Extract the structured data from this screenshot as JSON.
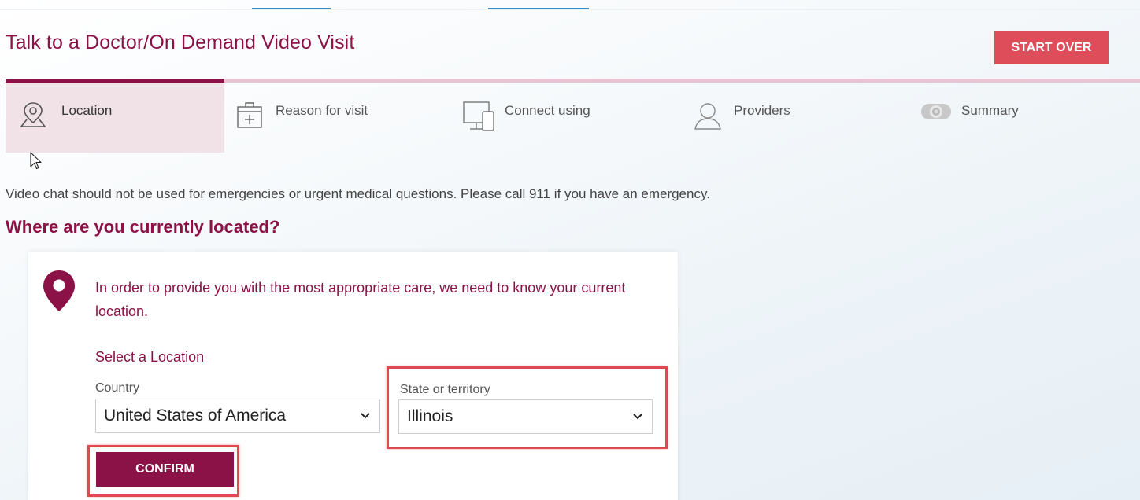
{
  "page": {
    "title": "Talk to a Doctor/On Demand Video Visit",
    "start_over_label": "START OVER",
    "accent_color": "#8b1246",
    "button_color": "#de4d5a"
  },
  "steps": [
    {
      "label": "Location",
      "icon": "map-pin-icon",
      "active": true
    },
    {
      "label": "Reason for visit",
      "icon": "first-aid-kit-icon",
      "active": false
    },
    {
      "label": "Connect using",
      "icon": "devices-icon",
      "active": false
    },
    {
      "label": "Providers",
      "icon": "person-icon",
      "active": false
    },
    {
      "label": "Summary",
      "icon": "webcam-icon",
      "active": false
    }
  ],
  "notice": "Video chat should not be used for emergencies or urgent medical questions.  Please call 911 if you have an emergency.",
  "question": "Where are you currently located?",
  "card": {
    "intro": "In order to provide you with the most appropriate care, we need to know your current location.",
    "select_heading": "Select a Location",
    "country": {
      "label": "Country",
      "value": "United States of America"
    },
    "state": {
      "label": "State or territory",
      "value": "Illinois"
    },
    "confirm_label": "CONFIRM"
  }
}
